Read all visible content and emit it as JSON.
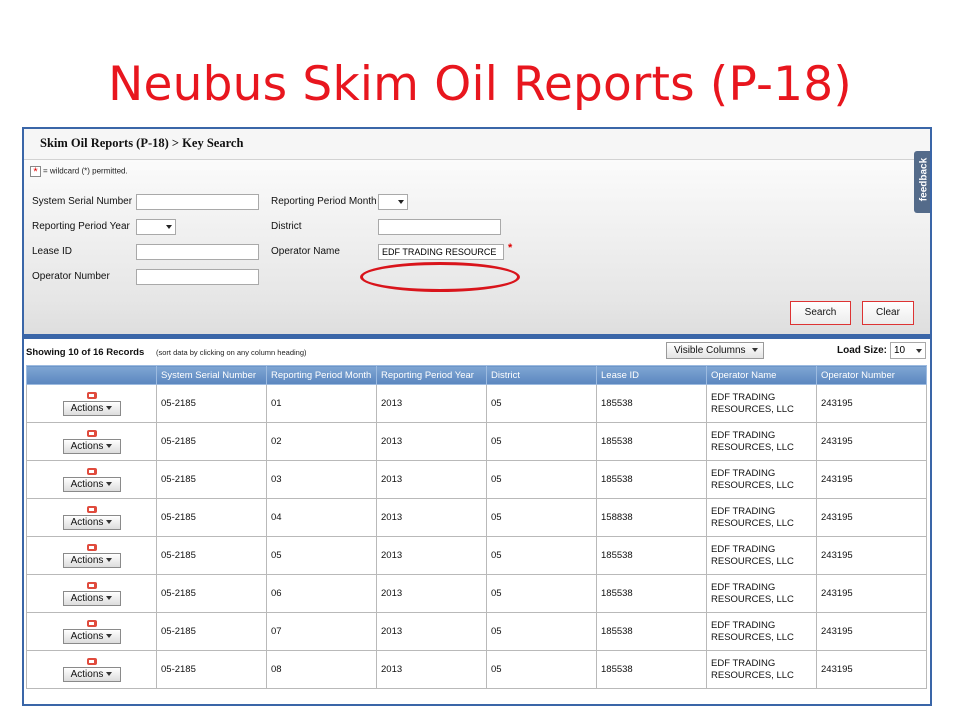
{
  "slide_title": "Neubus Skim Oil Reports (P-18)",
  "breadcrumb": "Skim Oil Reports (P-18) > Key Search",
  "wildcard_note": "= wildcard (*) permitted.",
  "wildcard_star": "*",
  "form": {
    "system_serial_number": {
      "label": "System Serial Number",
      "value": ""
    },
    "reporting_period_year": {
      "label": "Reporting Period Year",
      "value": ""
    },
    "lease_id": {
      "label": "Lease ID",
      "value": ""
    },
    "operator_number": {
      "label": "Operator Number",
      "value": ""
    },
    "reporting_period_month": {
      "label": "Reporting Period Month",
      "value": ""
    },
    "district": {
      "label": "District",
      "value": ""
    },
    "operator_name": {
      "label": "Operator Name",
      "value": "EDF TRADING RESOURCE"
    }
  },
  "buttons": {
    "search": "Search",
    "clear": "Clear"
  },
  "feedback_label": "feedback",
  "results": {
    "showing": "Showing 10 of 16 Records",
    "sort_note": "(sort data by clicking on any column heading)",
    "visible_columns_label": "Visible Columns",
    "load_size_label": "Load Size:",
    "load_size_value": "10"
  },
  "table": {
    "actions_label": "Actions",
    "columns": [
      "",
      "System Serial Number",
      "Reporting Period Month",
      "Reporting Period Year",
      "District",
      "Lease ID",
      "Operator Name",
      "Operator Number"
    ],
    "rows": [
      [
        "05-2185",
        "01",
        "2013",
        "05",
        "185538",
        "EDF TRADING RESOURCES, LLC",
        "243195"
      ],
      [
        "05-2185",
        "02",
        "2013",
        "05",
        "185538",
        "EDF TRADING RESOURCES, LLC",
        "243195"
      ],
      [
        "05-2185",
        "03",
        "2013",
        "05",
        "185538",
        "EDF TRADING RESOURCES, LLC",
        "243195"
      ],
      [
        "05-2185",
        "04",
        "2013",
        "05",
        "158838",
        "EDF TRADING RESOURCES, LLC",
        "243195"
      ],
      [
        "05-2185",
        "05",
        "2013",
        "05",
        "185538",
        "EDF TRADING RESOURCES, LLC",
        "243195"
      ],
      [
        "05-2185",
        "06",
        "2013",
        "05",
        "185538",
        "EDF TRADING RESOURCES, LLC",
        "243195"
      ],
      [
        "05-2185",
        "07",
        "2013",
        "05",
        "185538",
        "EDF TRADING RESOURCES, LLC",
        "243195"
      ],
      [
        "05-2185",
        "08",
        "2013",
        "05",
        "185538",
        "EDF TRADING RESOURCES, LLC",
        "243195"
      ]
    ]
  }
}
